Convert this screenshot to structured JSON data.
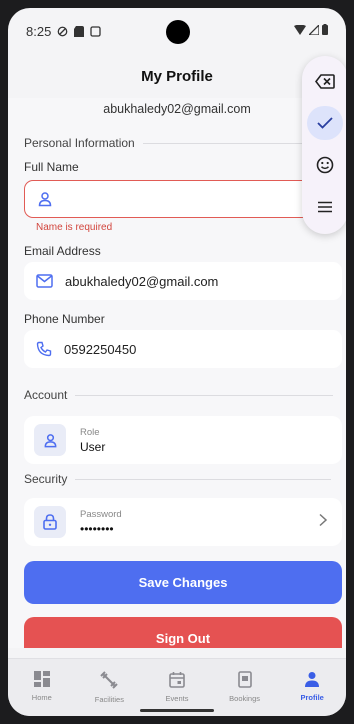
{
  "status": {
    "time": "8:25"
  },
  "app_bar": {
    "title": "My Profile"
  },
  "profile": {
    "email_display": "abukhaledy02@gmail.com"
  },
  "personal": {
    "section_title": "Personal Information",
    "full_name_label": "Full Name",
    "full_name_value": "",
    "full_name_error": "Name is required",
    "email_label": "Email Address",
    "email_value": "abukhaledy02@gmail.com",
    "phone_label": "Phone Number",
    "phone_value": "0592250450"
  },
  "account": {
    "section_title": "Account",
    "role_caption": "Role",
    "role_value": "User"
  },
  "security": {
    "section_title": "Security",
    "password_caption": "Password",
    "password_value": "••••••••"
  },
  "actions": {
    "save_label": "Save Changes",
    "signout_label": "Sign Out"
  },
  "bottom_nav": {
    "items": [
      {
        "label": "Home"
      },
      {
        "label": "Facilities"
      },
      {
        "label": "Events"
      },
      {
        "label": "Bookings"
      },
      {
        "label": "Profile"
      }
    ]
  },
  "colors": {
    "primary": "#4e6ef0",
    "danger": "#e55252",
    "error_border": "#e15b55",
    "active_nav": "#3a5ee6"
  },
  "icons": {
    "floating_toolbar": [
      "backspace-icon",
      "check-icon",
      "emoji-icon",
      "menu-icon"
    ]
  }
}
